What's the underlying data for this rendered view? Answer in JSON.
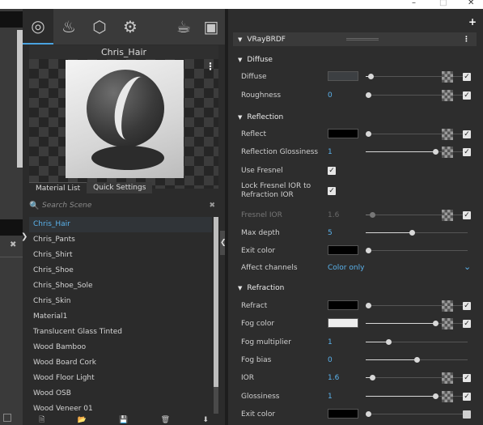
{
  "window": {
    "minimize": "–",
    "maximize": "□",
    "close": "✕"
  },
  "left_panel": {
    "tabs": [
      {
        "icon": "material-ball-icon",
        "glyph": "◎",
        "active": true
      },
      {
        "icon": "light-bulb-icon",
        "glyph": "♨",
        "active": false
      },
      {
        "icon": "geometry-cube-icon",
        "glyph": "⬡",
        "active": false
      },
      {
        "icon": "settings-gear-icon",
        "glyph": "⚙",
        "active": false
      },
      {
        "icon": "teapot-render-icon",
        "glyph": "☕",
        "active": false
      },
      {
        "icon": "frame-buffer-icon",
        "glyph": "▣",
        "active": false
      }
    ],
    "preview_title": "Chris_Hair",
    "preview_menu": "⋮",
    "panel_tabs": [
      "Material List",
      "Quick Settings"
    ],
    "search": {
      "placeholder": "Search Scene",
      "icon": "🔍",
      "clear": "✖"
    },
    "materials": [
      "Chris_Hair",
      "Chris_Pants",
      "Chris_Shirt",
      "Chris_Shoe",
      "Chris_Shoe_Sole",
      "Chris_Skin",
      "Material1",
      "Translucent Glass Tinted",
      "Wood Bamboo",
      "Wood Board Cork",
      "Wood Floor Light",
      "Wood OSB",
      "Wood Veneer 01"
    ],
    "selected_material": "Chris_Hair",
    "bottom_toolbar": [
      "🗎",
      "📂",
      "💾",
      "🗑",
      "⬇"
    ]
  },
  "right_panel": {
    "add_label": "+",
    "material_type": "VRayBRDF",
    "header_menu": "⋮",
    "sections": {
      "diffuse": "Diffuse",
      "reflection": "Reflection",
      "refraction": "Refraction"
    },
    "params": {
      "diffuse": {
        "label": "Diffuse",
        "color": "#3c3f42",
        "slider": 0.05
      },
      "roughness": {
        "label": "Roughness",
        "value": "0",
        "slider": 0.02
      },
      "reflect": {
        "label": "Reflect",
        "color": "#000000",
        "slider": 0.02
      },
      "reflection_glossiness": {
        "label": "Reflection Glossiness",
        "value": "1",
        "slider": 0.68
      },
      "use_fresnel": {
        "label": "Use Fresnel",
        "checked": true
      },
      "lock_fresnel": {
        "label": "Lock Fresnel IOR to Refraction IOR",
        "checked": true
      },
      "fresnel_ior": {
        "label": "Fresnel IOR",
        "value": "1.6",
        "slider": 0.06
      },
      "max_depth": {
        "label": "Max depth",
        "value": "5",
        "slider": 0.45
      },
      "exit_color_reflect": {
        "label": "Exit color",
        "color": "#000000",
        "slider": 0.02
      },
      "affect_channels": {
        "label": "Affect channels",
        "value": "Color only"
      },
      "refract": {
        "label": "Refract",
        "color": "#000000",
        "slider": 0.02
      },
      "fog_color": {
        "label": "Fog color",
        "color": "#eeeeee",
        "slider": 0.68
      },
      "fog_multiplier": {
        "label": "Fog multiplier",
        "value": "1",
        "slider": 0.22
      },
      "fog_bias": {
        "label": "Fog bias",
        "value": "0",
        "slider": 0.5
      },
      "ior": {
        "label": "IOR",
        "value": "1.6",
        "slider": 0.06
      },
      "glossiness": {
        "label": "Glossiness",
        "value": "1",
        "slider": 0.68
      },
      "exit_color_refract": {
        "label": "Exit color",
        "color": "#000000",
        "slider": 0.02
      }
    }
  },
  "colors": {
    "accent": "#4aa3e0",
    "selected_text": "#5ab2ec",
    "panel_bg": "#2d2d2d"
  }
}
